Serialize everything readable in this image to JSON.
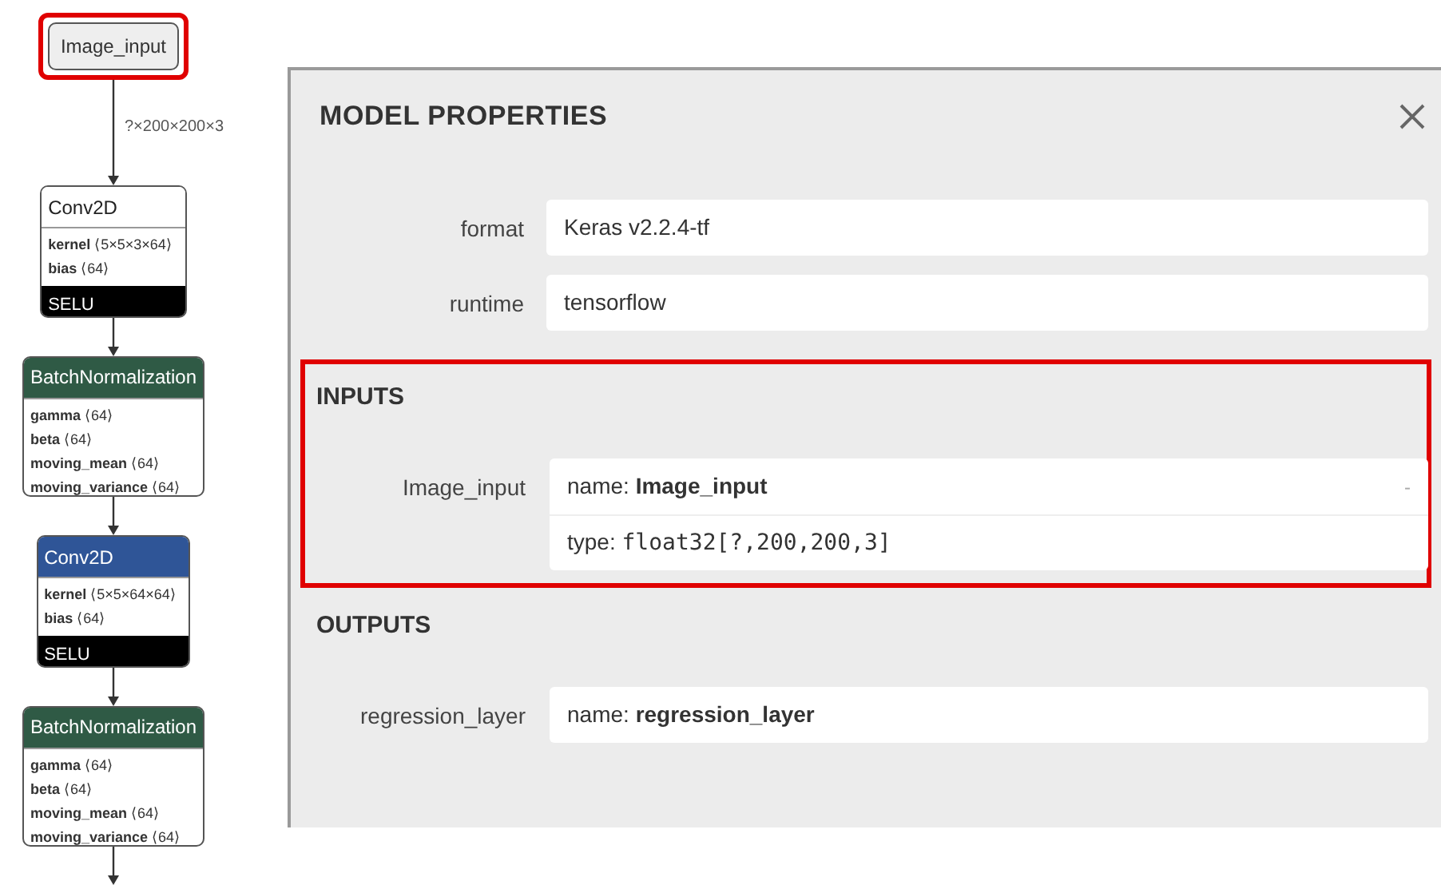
{
  "graph": {
    "nodes": [
      {
        "kind": "input",
        "title": "Image_input",
        "highlighted": true,
        "edge_label": "?×200×200×3"
      },
      {
        "kind": "layer",
        "title": "Conv2D",
        "color": "#ffffff",
        "attributes": [
          {
            "name": "kernel",
            "value": "⟨5×5×3×64⟩"
          },
          {
            "name": "bias",
            "value": "⟨64⟩"
          }
        ],
        "activation": "SELU"
      },
      {
        "kind": "layer",
        "title": "BatchNormalization",
        "color": "#2f5a45",
        "attributes": [
          {
            "name": "gamma",
            "value": "⟨64⟩"
          },
          {
            "name": "beta",
            "value": "⟨64⟩"
          },
          {
            "name": "moving_mean",
            "value": "⟨64⟩"
          },
          {
            "name": "moving_variance",
            "value": "⟨64⟩"
          }
        ]
      },
      {
        "kind": "layer",
        "title": "Conv2D",
        "color": "#2f5597",
        "attributes": [
          {
            "name": "kernel",
            "value": "⟨5×5×64×64⟩"
          },
          {
            "name": "bias",
            "value": "⟨64⟩"
          }
        ],
        "activation": "SELU"
      },
      {
        "kind": "layer",
        "title": "BatchNormalization",
        "color": "#2f5a45",
        "attributes": [
          {
            "name": "gamma",
            "value": "⟨64⟩"
          },
          {
            "name": "beta",
            "value": "⟨64⟩"
          },
          {
            "name": "moving_mean",
            "value": "⟨64⟩"
          },
          {
            "name": "moving_variance",
            "value": "⟨64⟩"
          }
        ]
      }
    ]
  },
  "panel": {
    "title": "MODEL PROPERTIES",
    "properties": [
      {
        "label": "format",
        "value": "Keras v2.2.4-tf"
      },
      {
        "label": "runtime",
        "value": "tensorflow"
      }
    ],
    "sections": [
      {
        "title": "INPUTS",
        "highlighted": true,
        "items": [
          {
            "label": "Image_input",
            "expander": "-",
            "fields": [
              {
                "key": "name:",
                "value": "Image_input",
                "kind": "bold"
              },
              {
                "key": "type:",
                "value": "float32[?,200,200,3]",
                "kind": "mono"
              }
            ]
          }
        ]
      },
      {
        "title": "OUTPUTS",
        "items": [
          {
            "label": "regression_layer",
            "fields": [
              {
                "key": "name:",
                "value": "regression_layer",
                "kind": "bold"
              }
            ]
          }
        ]
      }
    ]
  }
}
